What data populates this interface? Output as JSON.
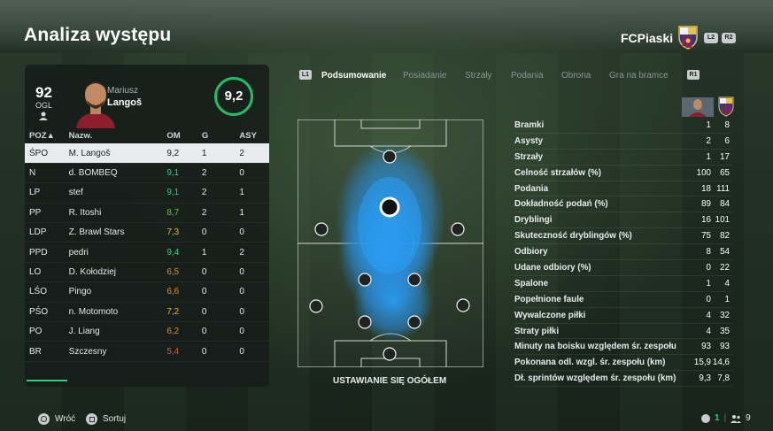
{
  "header": {
    "title": "Analiza występu",
    "club_name": "FCPiaski",
    "btn_l2": "L2",
    "btn_r2": "R2"
  },
  "player": {
    "ovr": "92",
    "ovr_label": "OGL",
    "first_name": "Mariusz",
    "last_name": "Langoš",
    "rating": "9,2"
  },
  "roster": {
    "headers": {
      "pos": "POZ▲",
      "name": "Nazw.",
      "om": "OM",
      "g": "G",
      "asy": "ASY"
    },
    "rows": [
      {
        "pos": "ŚPO",
        "name": "M. Langoš",
        "om": "9,2",
        "g": "1",
        "asy": "2",
        "om_color": "#16201a"
      },
      {
        "pos": "N",
        "name": "d. BOMBEQ",
        "om": "9,1",
        "g": "2",
        "asy": "0",
        "om_color": "#2fd07a"
      },
      {
        "pos": "LP",
        "name": "stef",
        "om": "9,1",
        "g": "2",
        "asy": "1",
        "om_color": "#2fd07a"
      },
      {
        "pos": "PP",
        "name": "R. Itoshi",
        "om": "8,7",
        "g": "2",
        "asy": "1",
        "om_color": "#6fbf4a"
      },
      {
        "pos": "LDP",
        "name": "Z. Brawl Stars",
        "om": "7,3",
        "g": "0",
        "asy": "0",
        "om_color": "#e6b72e"
      },
      {
        "pos": "PPD",
        "name": "pedri",
        "om": "9,4",
        "g": "1",
        "asy": "2",
        "om_color": "#2fd07a"
      },
      {
        "pos": "LO",
        "name": "D. Kołodziej",
        "om": "6,5",
        "g": "0",
        "asy": "0",
        "om_color": "#e8862c"
      },
      {
        "pos": "LŚO",
        "name": "Pingo",
        "om": "6,6",
        "g": "0",
        "asy": "0",
        "om_color": "#e8862c"
      },
      {
        "pos": "PŚO",
        "name": "n. Motomoto",
        "om": "7,2",
        "g": "0",
        "asy": "0",
        "om_color": "#e6b72e"
      },
      {
        "pos": "PO",
        "name": "J. Liang",
        "om": "6,2",
        "g": "0",
        "asy": "0",
        "om_color": "#e8862c"
      },
      {
        "pos": "BR",
        "name": "Szczesny",
        "om": "5,4",
        "g": "0",
        "asy": "0",
        "om_color": "#e2553a"
      }
    ]
  },
  "tabs": {
    "l1": "L1",
    "r1": "R1",
    "items": [
      "Podsumowanie",
      "Posiadanie",
      "Strzały",
      "Podania",
      "Obrona",
      "Gra na bramce"
    ]
  },
  "pitch": {
    "caption": "USTAWIANIE SIĘ OGÓŁEM"
  },
  "stats": [
    {
      "label": "Bramki",
      "v1": "1",
      "v2": "8"
    },
    {
      "label": "Asysty",
      "v1": "2",
      "v2": "6"
    },
    {
      "label": "Strzały",
      "v1": "1",
      "v2": "17"
    },
    {
      "label": "Celność strzałów (%)",
      "v1": "100",
      "v2": "65"
    },
    {
      "label": "Podania",
      "v1": "18",
      "v2": "111"
    },
    {
      "label": "Dokładność podań (%)",
      "v1": "89",
      "v2": "84"
    },
    {
      "label": "Dryblingi",
      "v1": "16",
      "v2": "101"
    },
    {
      "label": "Skuteczność dryblingów (%)",
      "v1": "75",
      "v2": "82"
    },
    {
      "label": "Odbiory",
      "v1": "8",
      "v2": "54"
    },
    {
      "label": "Udane odbiory (%)",
      "v1": "0",
      "v2": "22"
    },
    {
      "label": "Spalone",
      "v1": "1",
      "v2": "4"
    },
    {
      "label": "Popełnione faule",
      "v1": "0",
      "v2": "1"
    },
    {
      "label": "Wywalczone piłki",
      "v1": "4",
      "v2": "32"
    },
    {
      "label": "Straty piłki",
      "v1": "4",
      "v2": "35"
    },
    {
      "label": "Minuty na boisku względem śr. zespołu",
      "v1": "93",
      "v2": "93"
    },
    {
      "label": "Pokonana odl. wzgl. śr. zespołu (km)",
      "v1": "15,9",
      "v2": "14,6"
    },
    {
      "label": "Dł. sprintów względem śr. zespołu (km)",
      "v1": "9,3",
      "v2": "7,8"
    }
  ],
  "footer": {
    "back": "Wróć",
    "sort": "Sortuj",
    "online_count": "1",
    "players_count": "9"
  },
  "colors": {
    "accent_green": "#2fd07a",
    "heatmap": "#2a9df4"
  }
}
